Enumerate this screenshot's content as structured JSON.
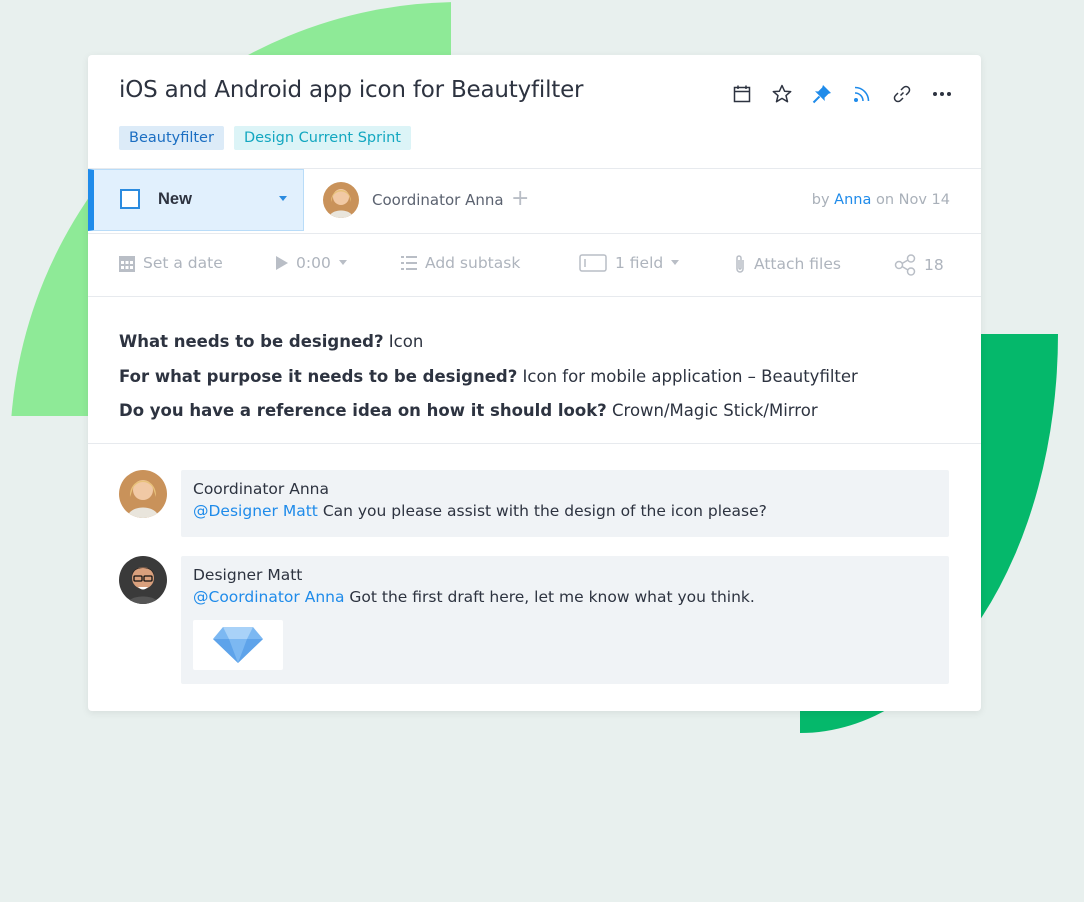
{
  "task": {
    "title": "iOS and Android app icon for Beautyfilter",
    "tags": [
      "Beautyfilter",
      "Design Current Sprint"
    ],
    "status": "New",
    "assignee": "Coordinator Anna",
    "author": {
      "prefix": "by",
      "name": "Anna",
      "date_prefix": "on",
      "date": "Nov 14"
    }
  },
  "header_icons": [
    "calendar-icon",
    "star-icon",
    "pin-icon",
    "rss-icon",
    "link-icon",
    "more-icon"
  ],
  "toolbar": {
    "date": "Set a date",
    "timer": "0:00",
    "subtask": "Add subtask",
    "field": "1 field",
    "attach": "Attach files",
    "share_count": "18"
  },
  "description": [
    {
      "q": "What needs to be designed?",
      "a": "Icon"
    },
    {
      "q": "For what purpose it needs to be designed?",
      "a": "Icon for mobile application – Beautyfilter"
    },
    {
      "q": "Do you have a reference idea on how it should look?",
      "a": "Crown/Magic Stick/Mirror"
    }
  ],
  "comments": [
    {
      "author": "Coordinator Anna",
      "mention": "@Designer Matt",
      "text": " Can you please assist with the design of the icon please?"
    },
    {
      "author": "Designer Matt",
      "mention": "@Coordinator Anna",
      "text": " Got the first draft here, let me know what you think."
    }
  ],
  "colors": {
    "accent": "#1f8bea",
    "green_light": "#8eea97",
    "green_dark": "#05b86b"
  }
}
